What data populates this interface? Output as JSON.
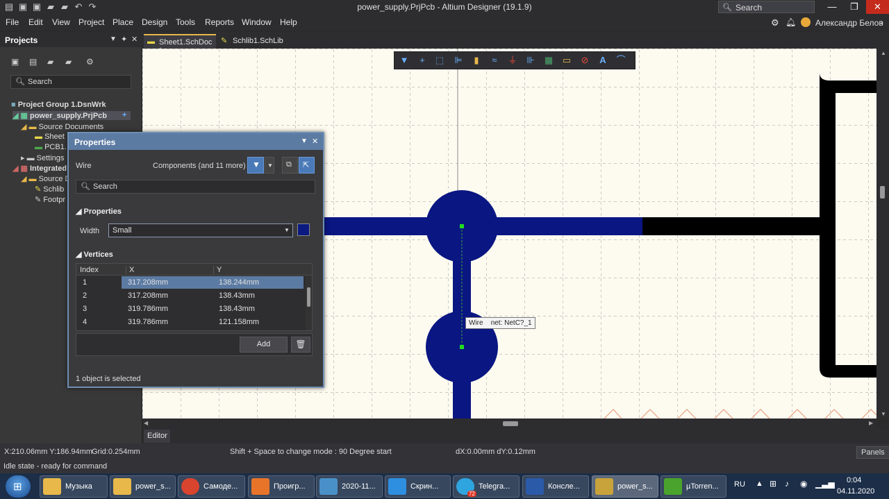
{
  "window": {
    "title": "power_supply.PrjPcb - Altium Designer (19.1.9)",
    "search_label": "Search",
    "user": "Александр Белов"
  },
  "menu": [
    "File",
    "Edit",
    "View",
    "Project",
    "Place",
    "Design",
    "Tools",
    "Reports",
    "Window",
    "Help"
  ],
  "projects_panel": {
    "title": "Projects",
    "search_placeholder": "Search",
    "tree": [
      {
        "label": "Project Group 1.DsnWrk"
      },
      {
        "label": "power_supply.PrjPcb"
      },
      {
        "label": "Source Documents"
      },
      {
        "label": "Sheet"
      },
      {
        "label": "PCB1."
      },
      {
        "label": "Settings"
      },
      {
        "label": "Integrated"
      },
      {
        "label": "Source D"
      },
      {
        "label": "Schlib"
      },
      {
        "label": "Footpr"
      }
    ]
  },
  "doc_tabs": [
    {
      "label": "Sheet1.SchDoc *"
    },
    {
      "label": "Schlib1.SchLib"
    }
  ],
  "properties_panel": {
    "title": "Properties",
    "object_type": "Wire",
    "filter_label": "Components (and 11 more)",
    "search_placeholder": "Search",
    "section_properties": "Properties",
    "width_label": "Width",
    "width_value": "Small",
    "width_color": "#0a1a80",
    "section_vertices": "Vertices",
    "columns": [
      "Index",
      "X",
      "Y"
    ],
    "vertices": [
      {
        "index": "1",
        "x": "317.208mm",
        "y": "138.244mm"
      },
      {
        "index": "2",
        "x": "317.208mm",
        "y": "138.43mm"
      },
      {
        "index": "3",
        "x": "319.786mm",
        "y": "138.43mm"
      },
      {
        "index": "4",
        "x": "319.786mm",
        "y": "121.158mm"
      }
    ],
    "add_label": "Add",
    "status": "1 object is selected"
  },
  "canvas": {
    "tooltip_type": "Wire",
    "tooltip_net": "net: NetC?_1",
    "wire_color": "#0a1682",
    "editor_tab": "Editor"
  },
  "status_bar": {
    "coords": "X:210.06mm Y:186.94mm",
    "grid": "Grid:0.254mm",
    "hint": "Shift + Space to change mode : 90 Degree start",
    "delta": "dX:0.00mm dY:0.12mm",
    "panels_label": "Panels",
    "state": "Idle state - ready for command"
  },
  "taskbar": {
    "items": [
      {
        "label": "Музыка",
        "color": "#e8b84a"
      },
      {
        "label": "power_s...",
        "color": "#e8b84a"
      },
      {
        "label": "Самоде...",
        "color": "#d9442f"
      },
      {
        "label": "Проигр...",
        "color": "#e8742a"
      },
      {
        "label": "2020-11...",
        "color": "#4a90c8"
      },
      {
        "label": "Скрин...",
        "color": "#2e8ee0"
      },
      {
        "label": "Telegra...",
        "color": "#2fa5e0"
      },
      {
        "label": "Консле...",
        "color": "#2b5aa8"
      },
      {
        "label": "power_s...",
        "color": "#c8a23a"
      },
      {
        "label": "µTorren...",
        "color": "#4aa32c"
      }
    ],
    "telegram_badge": "72",
    "lang": "RU",
    "time": "0:04",
    "date": "04.11.2020"
  }
}
